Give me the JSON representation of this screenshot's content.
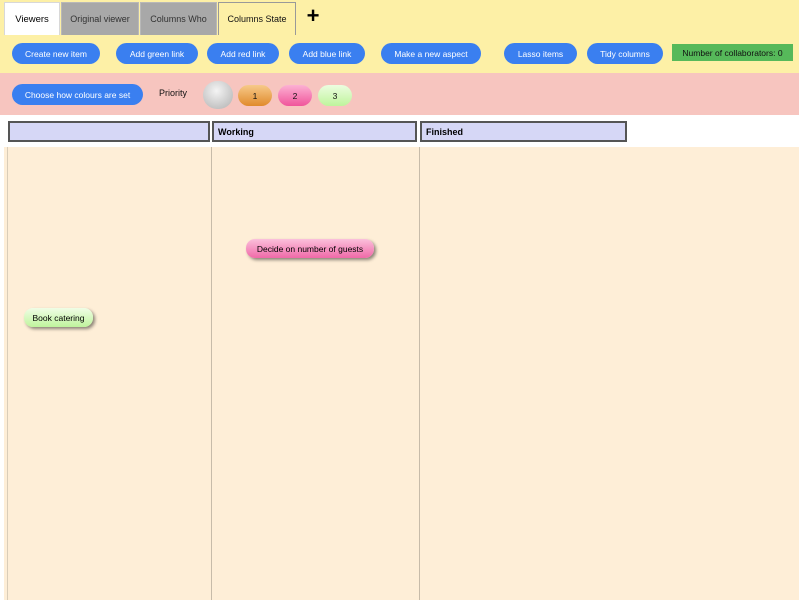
{
  "tabs": [
    {
      "label": "Viewers"
    },
    {
      "label": "Original viewer"
    },
    {
      "label": "Columns Who"
    },
    {
      "label": "Columns State"
    }
  ],
  "add_tab_label": "+",
  "toolbar": {
    "create_item": "Create new item",
    "add_green_link": "Add green link",
    "add_red_link": "Add red link",
    "add_blue_link": "Add blue link",
    "make_aspect": "Make a new aspect",
    "lasso_items": "Lasso items",
    "tidy_columns": "Tidy columns",
    "collaborators": "Number of collaborators: 0"
  },
  "colour_row": {
    "choose_colours": "Choose how colours are set",
    "priority_label": "Priority",
    "chips": [
      {
        "label": "",
        "color": "#c8c8c8"
      },
      {
        "label": "1",
        "color": "#eea64c"
      },
      {
        "label": "2",
        "color": "#f77bb2"
      },
      {
        "label": "3",
        "color": "#cff7b4"
      }
    ]
  },
  "columns": [
    {
      "label": ""
    },
    {
      "label": "Working"
    },
    {
      "label": "Finished"
    }
  ],
  "items": [
    {
      "label": "Decide on number of guests",
      "color": "#f47bb6"
    },
    {
      "label": "Book catering",
      "color": "#ccf7b3"
    }
  ],
  "colors": {
    "accent": "#3a7ff0",
    "toolbar_bg": "#fdf0a6",
    "colour_row_bg": "#f7c5bf",
    "board_bg": "#feeed7",
    "column_header_bg": "#d6d7f6",
    "collaborators_badge": "#56b95a"
  }
}
